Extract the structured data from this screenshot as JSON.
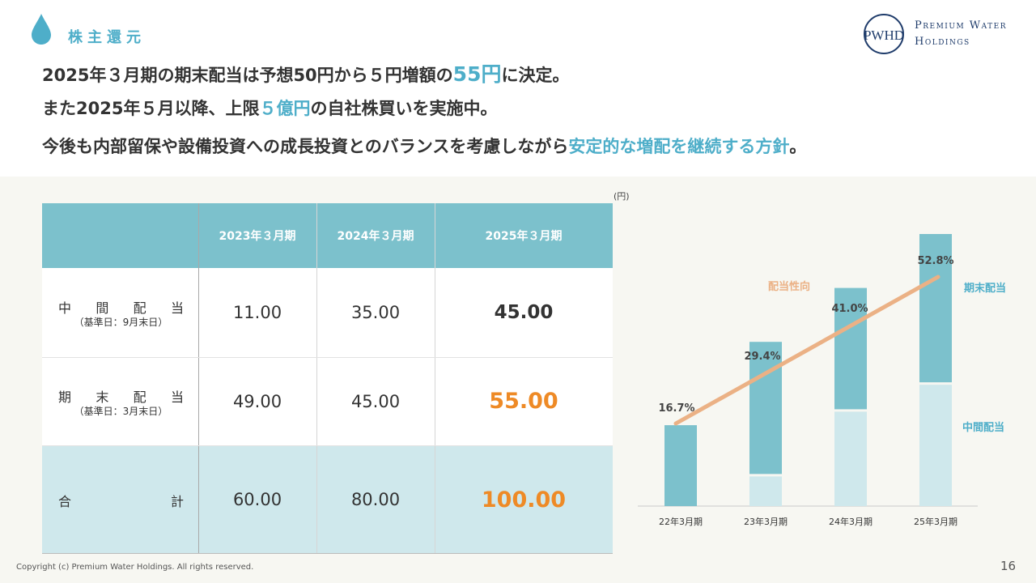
{
  "header": {
    "section_title": "株主還元",
    "logo_monogram": "PWHD",
    "logo_line1": "Premium Water",
    "logo_line2": "Holdings"
  },
  "headlines": [
    {
      "pre": "2025年３月期の期末配当は予想50円から５円増額の",
      "hl": "55円",
      "post": "に決定。"
    },
    {
      "pre": "また2025年５月以降、上限",
      "hl": "５億円",
      "post": "の自社株買いを実施中。"
    },
    {
      "pre": "今後も内部留保や設備投資への成長投資とのバランスを考慮しながら",
      "hl": "安定的な増配を継続する方針",
      "post": "。"
    }
  ],
  "table": {
    "columns": [
      "2023年３月期",
      "2024年３月期",
      "2025年３月期"
    ],
    "rows": [
      {
        "label": "中間配当",
        "sub": "（基準日：9月末日）",
        "values": [
          "11.00",
          "35.00",
          "45.00"
        ]
      },
      {
        "label": "期末配当",
        "sub": "（基準日：3月末日）",
        "values": [
          "49.00",
          "45.00",
          "55.00"
        ]
      },
      {
        "label": "合計",
        "sub": "",
        "values": [
          "60.00",
          "80.00",
          "100.00"
        ]
      }
    ]
  },
  "chart_data": {
    "type": "bar",
    "unit": "(円)",
    "categories": [
      "22年3月期",
      "23年3月期",
      "24年3月期",
      "25年3月期"
    ],
    "series": [
      {
        "name": "中間配当",
        "values": [
          0,
          11,
          35,
          45
        ],
        "color": "#cfe8ec"
      },
      {
        "name": "期末配当",
        "values": [
          30,
          49,
          45,
          55
        ],
        "color": "#7cc1cc"
      }
    ],
    "line": {
      "name": "配当性向",
      "values": [
        16.7,
        29.4,
        41.0,
        52.8
      ],
      "labels": [
        "16.7%",
        "29.4%",
        "41.0%",
        "52.8%"
      ],
      "color": "#ebb185"
    },
    "ylim": [
      0,
      100
    ]
  },
  "footer": {
    "copyright": "Copyright (c) Premium Water Holdings. All rights reserved.",
    "page": "16"
  },
  "colors": {
    "accent": "#4eaec9",
    "orange": "#ee8a26",
    "teal": "#7cc1cc",
    "light_teal": "#cfe8ec"
  }
}
